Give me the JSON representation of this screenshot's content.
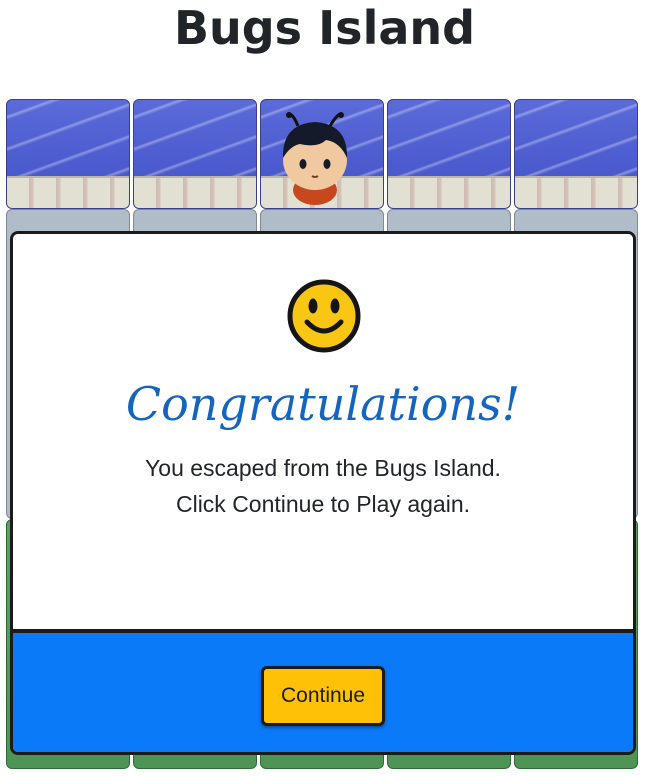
{
  "header": {
    "title": "Bugs Island"
  },
  "board": {
    "row0_tiles": [
      "water",
      "water",
      "water",
      "water",
      "water"
    ],
    "player_icon": "player-character-icon"
  },
  "modal": {
    "icon": "smiley-face-icon",
    "heading": "Congratulations!",
    "message_line1": "You escaped from the Bugs Island.",
    "message_line2": "Click Continue to Play again.",
    "continue_label": "Continue"
  },
  "colors": {
    "heading": "#1565c0",
    "footer": "#0a7af8",
    "button": "#ffc107",
    "water": "#4d5ccf",
    "grass": "#4e9454"
  }
}
